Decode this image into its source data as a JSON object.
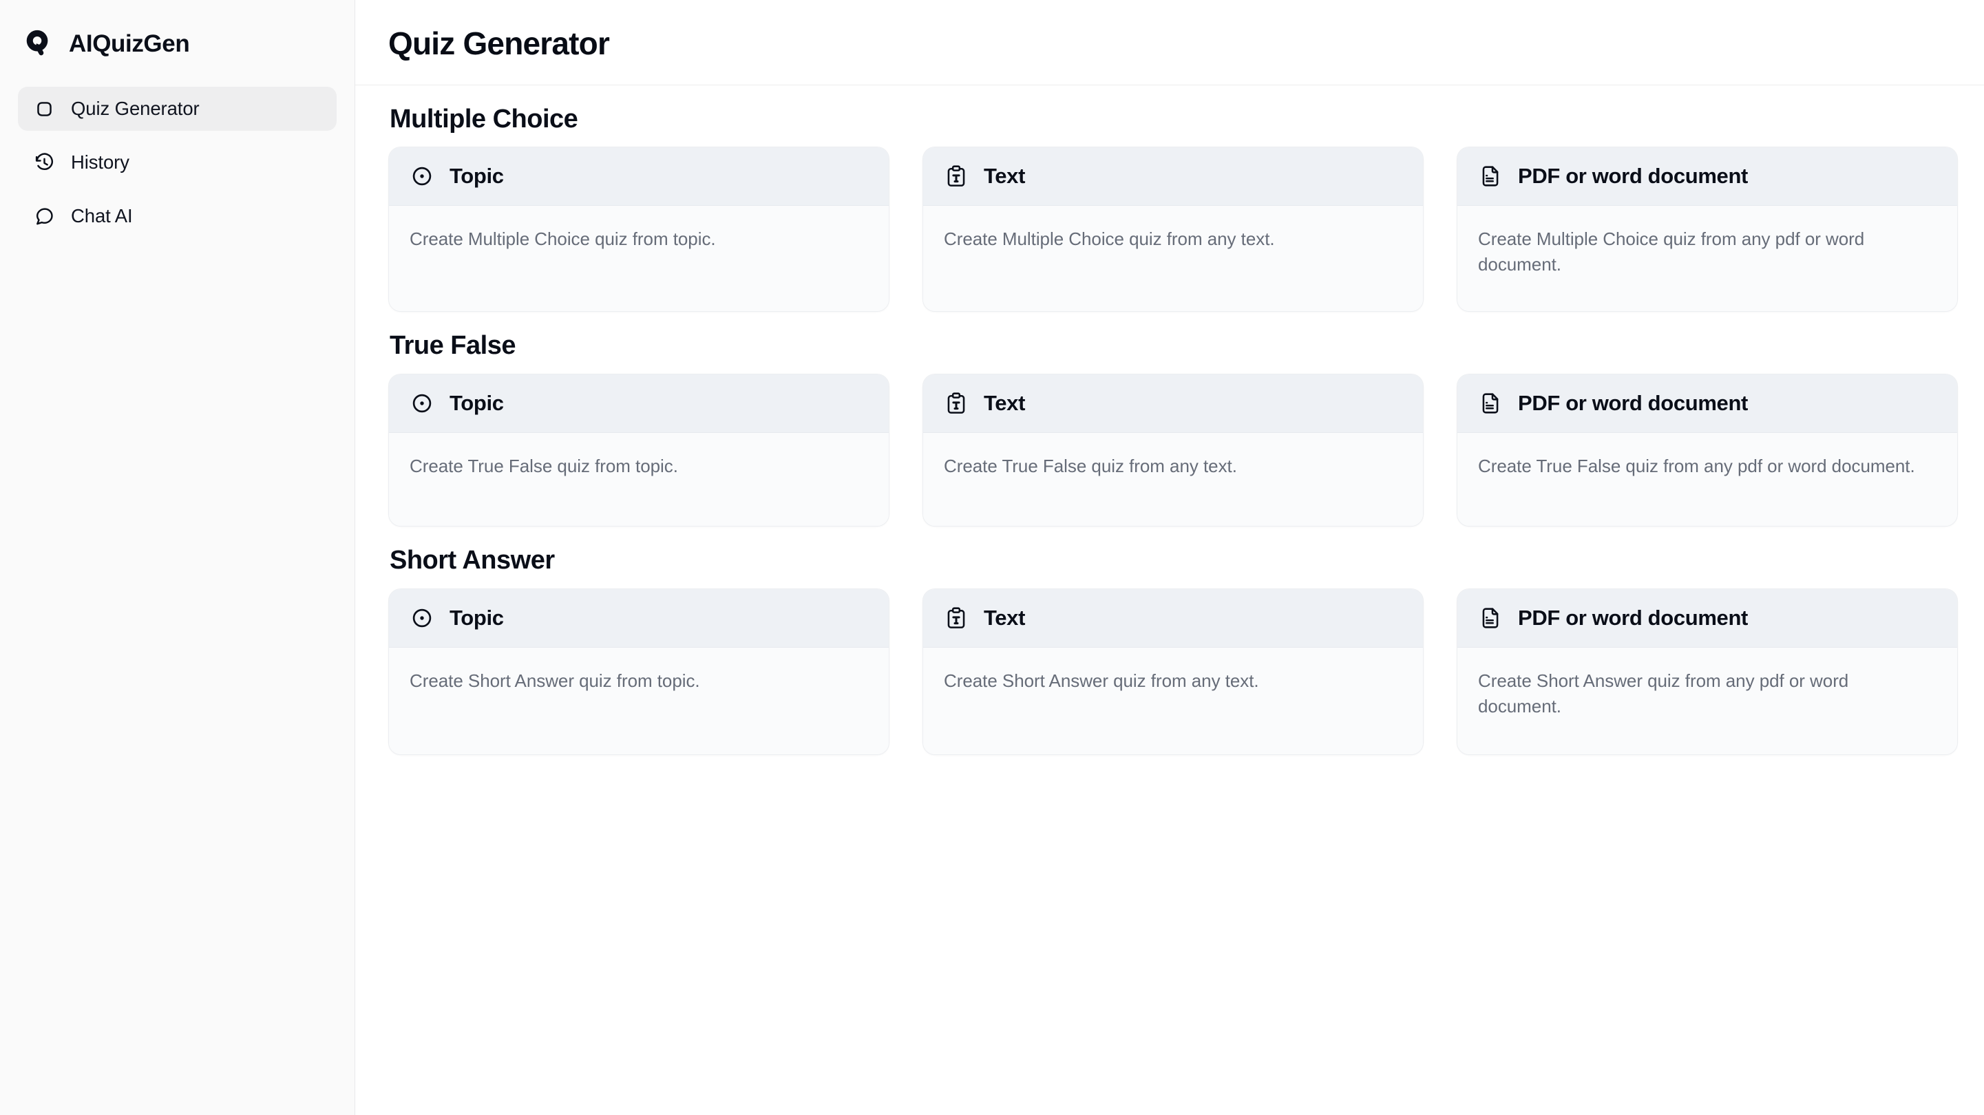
{
  "brand": {
    "name": "AIQuizGen",
    "logo_icon": "quiz-logo-icon"
  },
  "sidebar": {
    "items": [
      {
        "label": "Quiz Generator",
        "icon": "squircle-icon",
        "active": true
      },
      {
        "label": "History",
        "icon": "history-clock-icon",
        "active": false
      },
      {
        "label": "Chat AI",
        "icon": "chat-bubble-icon",
        "active": false
      }
    ]
  },
  "header": {
    "title": "Quiz Generator"
  },
  "colors": {
    "page_bg": "#ffffff",
    "sidebar_bg": "#fafafa",
    "sidebar_border": "#e8e8ea",
    "nav_active_bg": "#eeeeef",
    "card_border": "#eceef1",
    "card_head_bg": "#eef1f5",
    "card_body_bg": "#fafbfc",
    "title_color": "#0a0e18",
    "muted_text": "#666c78"
  },
  "sections": [
    {
      "id": "multiple-choice",
      "title": "Multiple Choice",
      "cards": [
        {
          "id": "mc-topic",
          "title": "Topic",
          "icon": "circle-dot-icon",
          "description": "Create Multiple Choice quiz from topic."
        },
        {
          "id": "mc-text",
          "title": "Text",
          "icon": "clipboard-text-icon",
          "description": "Create Multiple Choice quiz from any text."
        },
        {
          "id": "mc-document",
          "title": "PDF or word document",
          "icon": "file-text-icon",
          "description": "Create Multiple Choice quiz from any pdf or word document."
        }
      ]
    },
    {
      "id": "true-false",
      "title": "True False",
      "cards": [
        {
          "id": "tf-topic",
          "title": "Topic",
          "icon": "circle-dot-icon",
          "description": "Create True False quiz from topic."
        },
        {
          "id": "tf-text",
          "title": "Text",
          "icon": "clipboard-text-icon",
          "description": "Create True False quiz from any text."
        },
        {
          "id": "tf-document",
          "title": "PDF or word document",
          "icon": "file-text-icon",
          "description": "Create True False quiz from any pdf or word document."
        }
      ]
    },
    {
      "id": "short-answer",
      "title": "Short Answer",
      "cards": [
        {
          "id": "sa-topic",
          "title": "Topic",
          "icon": "circle-dot-icon",
          "description": "Create Short Answer quiz from topic."
        },
        {
          "id": "sa-text",
          "title": "Text",
          "icon": "clipboard-text-icon",
          "description": "Create Short Answer quiz from any text."
        },
        {
          "id": "sa-document",
          "title": "PDF or word document",
          "icon": "file-text-icon",
          "description": "Create Short Answer quiz from any pdf or word document."
        }
      ]
    }
  ]
}
